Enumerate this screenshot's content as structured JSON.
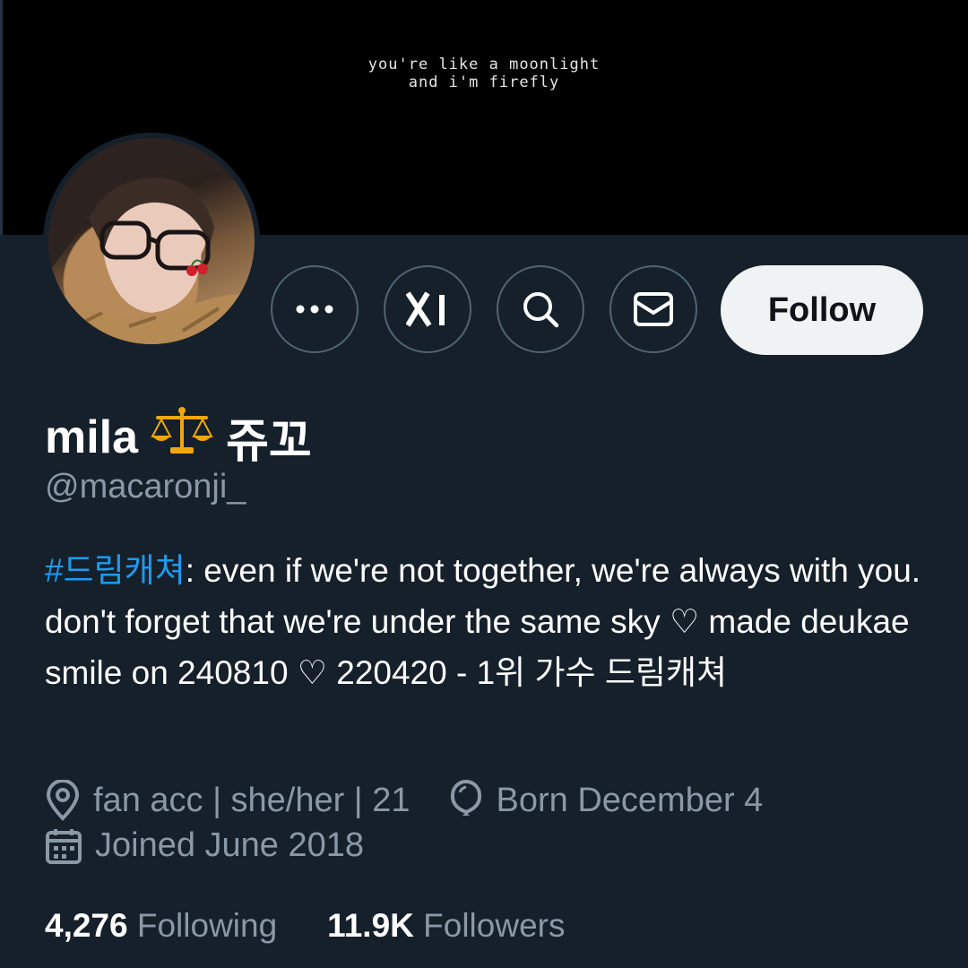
{
  "banner": {
    "text": "you're like a moonlight\nand i'm firefly"
  },
  "actions": {
    "more_label": "More",
    "grok_label": "Grok",
    "search_label": "Search",
    "message_label": "Message",
    "follow_label": "Follow"
  },
  "profile": {
    "display_name": "mila",
    "display_name_emoji": "⚖️",
    "display_name_suffix": "쥬꼬",
    "handle": "@macaronji_",
    "bio_hashtag": "#드림캐쳐",
    "bio_text": ": even if we're not together, we're always with you. don't forget that we're under the same sky ♡ made deukae smile on 240810 ♡ 220420 - 1위 가수 드림캐쳐",
    "location": "fan acc | she/her | 21",
    "birthday": "Born December 4",
    "joined": "Joined June 2018"
  },
  "stats": {
    "following_count": "4,276",
    "following_label": "Following",
    "followers_count": "11.9K",
    "followers_label": "Followers"
  },
  "colors": {
    "background": "#15202b",
    "accent": "#1d9bf0",
    "secondary_text": "#8b98a5"
  }
}
